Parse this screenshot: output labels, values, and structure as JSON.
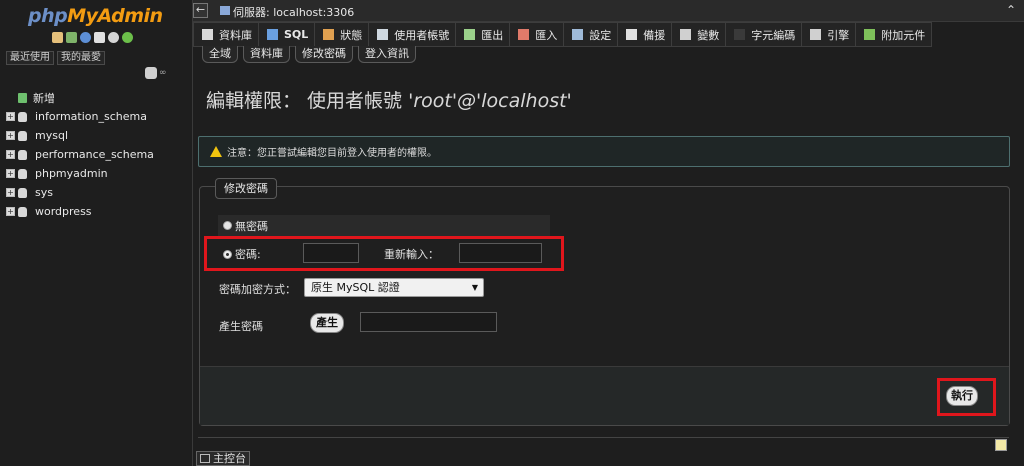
{
  "nav": {
    "logo_part1": "php",
    "logo_part2": "MyAdmin",
    "tab_recent": "最近使用",
    "tab_favorites": "我的最愛",
    "new_label": "新增",
    "databases": [
      "information_schema",
      "mysql",
      "performance_schema",
      "phpmyadmin",
      "sys",
      "wordpress"
    ]
  },
  "topbar": {
    "back": "←",
    "server": "伺服器: localhost:3306",
    "toggle": "⌃"
  },
  "menu": [
    {
      "label": "資料庫",
      "icon": "database-icon",
      "bold": false
    },
    {
      "label": "SQL",
      "icon": "sql-icon",
      "bold": true
    },
    {
      "label": "狀態",
      "icon": "status-icon",
      "bold": false
    },
    {
      "label": "使用者帳號",
      "icon": "users-icon",
      "bold": false
    },
    {
      "label": "匯出",
      "icon": "export-icon",
      "bold": false
    },
    {
      "label": "匯入",
      "icon": "import-icon",
      "bold": false
    },
    {
      "label": "設定",
      "icon": "wrench-icon",
      "bold": false
    },
    {
      "label": "備援",
      "icon": "replication-icon",
      "bold": false
    },
    {
      "label": "變數",
      "icon": "variables-icon",
      "bold": false
    },
    {
      "label": "字元編碼",
      "icon": "charset-icon",
      "bold": false
    },
    {
      "label": "引擎",
      "icon": "engine-icon",
      "bold": false
    },
    {
      "label": "附加元件",
      "icon": "plugin-icon",
      "bold": false
    }
  ],
  "subtabs": [
    "全域",
    "資料庫",
    "修改密碼",
    "登入資訊"
  ],
  "title": {
    "prefix": "編輯權限： 使用者帳號",
    "user": "'root'@'localhost'"
  },
  "notice": "注意：您正嘗試編輯您目前登入使用者的權限。",
  "form": {
    "legend": "修改密碼",
    "no_password": "無密碼",
    "password": "密碼:",
    "retype": "重新輸入：",
    "hash_label": "密碼加密方式：",
    "hash_value": "原生 MySQL 認證",
    "generate_label": "產生密碼",
    "generate_button": "產生",
    "go_button": "執行"
  },
  "console": "主控台"
}
